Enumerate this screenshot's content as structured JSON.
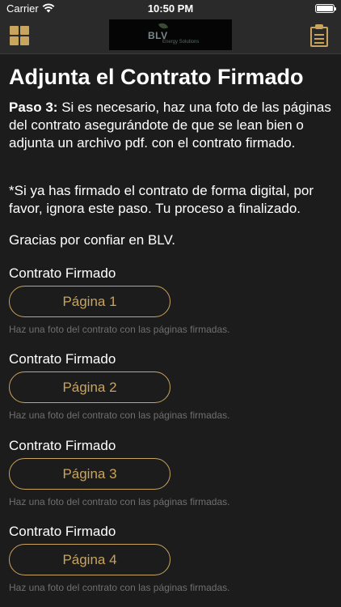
{
  "status_bar": {
    "carrier": "Carrier",
    "time": "10:50 PM"
  },
  "nav": {
    "logo_text": "BLV",
    "logo_subtext": "Energy Solutions",
    "left_icon": "grid-icon",
    "right_icon": "clipboard-icon",
    "accent_color": "#c9a45c"
  },
  "main": {
    "title": "Adjunta el Contrato Firmado",
    "step_label": "Paso 3:",
    "step_text": " Si es necesario, haz una foto de las páginas del contrato asegurándote de que se lean bien o adjunta un archivo pdf. con el contrato firmado.",
    "note": "*Si ya has firmado el contrato de forma digital, por favor, ignora este paso. Tu proceso a finalizado.",
    "thanks": "Gracias por confiar en BLV.",
    "sections": [
      {
        "label": "Contrato Firmado",
        "button": "Página 1",
        "hint": "Haz una foto del contrato con las páginas firmadas."
      },
      {
        "label": "Contrato Firmado",
        "button": "Página 2",
        "hint": "Haz una foto del contrato con las páginas firmadas."
      },
      {
        "label": "Contrato Firmado",
        "button": "Página 3",
        "hint": "Haz una foto del contrato con las páginas firmadas."
      },
      {
        "label": "Contrato Firmado",
        "button": "Página 4",
        "hint": "Haz una foto del contrato con las páginas firmadas."
      }
    ]
  }
}
